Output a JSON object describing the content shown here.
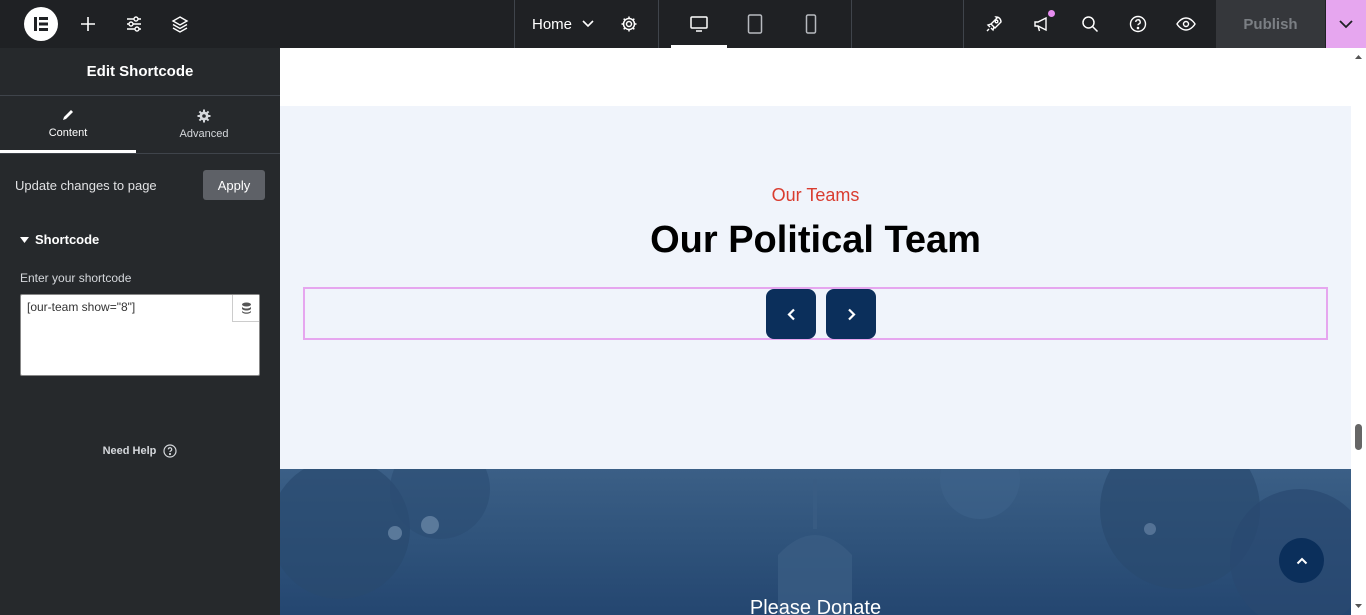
{
  "topbar": {
    "page_name": "Home",
    "publish_label": "Publish",
    "icons": [
      "elementor-logo-icon",
      "plus-icon",
      "sliders-icon",
      "layers-icon",
      "chevron-down-icon",
      "gear-icon",
      "desktop-icon",
      "tablet-icon",
      "mobile-icon",
      "rocket-icon",
      "megaphone-icon",
      "search-icon",
      "help-icon",
      "eye-icon"
    ],
    "publish_dropdown_color": "#e6a6ef"
  },
  "panel": {
    "title": "Edit Shortcode",
    "tabs": [
      {
        "label": "Content",
        "icon": "pencil-icon",
        "active": true
      },
      {
        "label": "Advanced",
        "icon": "gear-icon",
        "active": false
      }
    ],
    "update_text": "Update changes to page",
    "apply_label": "Apply",
    "section_title": "Shortcode",
    "field_label": "Enter your shortcode",
    "shortcode_value": "[our-team show=\"8\"]",
    "need_help": "Need Help"
  },
  "canvas": {
    "eyebrow": "Our Teams",
    "heading": "Our Political Team",
    "donate_title": "Please Donate",
    "accent_red": "#d93c2f",
    "navy": "#0b2f5b"
  }
}
